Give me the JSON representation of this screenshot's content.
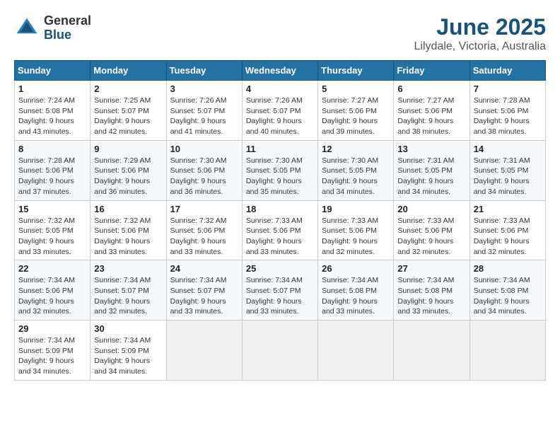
{
  "header": {
    "logo_general": "General",
    "logo_blue": "Blue",
    "month_title": "June 2025",
    "location": "Lilydale, Victoria, Australia"
  },
  "days_of_week": [
    "Sunday",
    "Monday",
    "Tuesday",
    "Wednesday",
    "Thursday",
    "Friday",
    "Saturday"
  ],
  "weeks": [
    [
      {
        "day": "1",
        "sunrise": "7:24 AM",
        "sunset": "5:08 PM",
        "daylight": "9 hours and 43 minutes."
      },
      {
        "day": "2",
        "sunrise": "7:25 AM",
        "sunset": "5:07 PM",
        "daylight": "9 hours and 42 minutes."
      },
      {
        "day": "3",
        "sunrise": "7:26 AM",
        "sunset": "5:07 PM",
        "daylight": "9 hours and 41 minutes."
      },
      {
        "day": "4",
        "sunrise": "7:26 AM",
        "sunset": "5:07 PM",
        "daylight": "9 hours and 40 minutes."
      },
      {
        "day": "5",
        "sunrise": "7:27 AM",
        "sunset": "5:06 PM",
        "daylight": "9 hours and 39 minutes."
      },
      {
        "day": "6",
        "sunrise": "7:27 AM",
        "sunset": "5:06 PM",
        "daylight": "9 hours and 38 minutes."
      },
      {
        "day": "7",
        "sunrise": "7:28 AM",
        "sunset": "5:06 PM",
        "daylight": "9 hours and 38 minutes."
      }
    ],
    [
      {
        "day": "8",
        "sunrise": "7:28 AM",
        "sunset": "5:06 PM",
        "daylight": "9 hours and 37 minutes."
      },
      {
        "day": "9",
        "sunrise": "7:29 AM",
        "sunset": "5:06 PM",
        "daylight": "9 hours and 36 minutes."
      },
      {
        "day": "10",
        "sunrise": "7:30 AM",
        "sunset": "5:06 PM",
        "daylight": "9 hours and 36 minutes."
      },
      {
        "day": "11",
        "sunrise": "7:30 AM",
        "sunset": "5:05 PM",
        "daylight": "9 hours and 35 minutes."
      },
      {
        "day": "12",
        "sunrise": "7:30 AM",
        "sunset": "5:05 PM",
        "daylight": "9 hours and 34 minutes."
      },
      {
        "day": "13",
        "sunrise": "7:31 AM",
        "sunset": "5:05 PM",
        "daylight": "9 hours and 34 minutes."
      },
      {
        "day": "14",
        "sunrise": "7:31 AM",
        "sunset": "5:05 PM",
        "daylight": "9 hours and 34 minutes."
      }
    ],
    [
      {
        "day": "15",
        "sunrise": "7:32 AM",
        "sunset": "5:05 PM",
        "daylight": "9 hours and 33 minutes."
      },
      {
        "day": "16",
        "sunrise": "7:32 AM",
        "sunset": "5:06 PM",
        "daylight": "9 hours and 33 minutes."
      },
      {
        "day": "17",
        "sunrise": "7:32 AM",
        "sunset": "5:06 PM",
        "daylight": "9 hours and 33 minutes."
      },
      {
        "day": "18",
        "sunrise": "7:33 AM",
        "sunset": "5:06 PM",
        "daylight": "9 hours and 33 minutes."
      },
      {
        "day": "19",
        "sunrise": "7:33 AM",
        "sunset": "5:06 PM",
        "daylight": "9 hours and 32 minutes."
      },
      {
        "day": "20",
        "sunrise": "7:33 AM",
        "sunset": "5:06 PM",
        "daylight": "9 hours and 32 minutes."
      },
      {
        "day": "21",
        "sunrise": "7:33 AM",
        "sunset": "5:06 PM",
        "daylight": "9 hours and 32 minutes."
      }
    ],
    [
      {
        "day": "22",
        "sunrise": "7:34 AM",
        "sunset": "5:06 PM",
        "daylight": "9 hours and 32 minutes."
      },
      {
        "day": "23",
        "sunrise": "7:34 AM",
        "sunset": "5:07 PM",
        "daylight": "9 hours and 32 minutes."
      },
      {
        "day": "24",
        "sunrise": "7:34 AM",
        "sunset": "5:07 PM",
        "daylight": "9 hours and 33 minutes."
      },
      {
        "day": "25",
        "sunrise": "7:34 AM",
        "sunset": "5:07 PM",
        "daylight": "9 hours and 33 minutes."
      },
      {
        "day": "26",
        "sunrise": "7:34 AM",
        "sunset": "5:08 PM",
        "daylight": "9 hours and 33 minutes."
      },
      {
        "day": "27",
        "sunrise": "7:34 AM",
        "sunset": "5:08 PM",
        "daylight": "9 hours and 33 minutes."
      },
      {
        "day": "28",
        "sunrise": "7:34 AM",
        "sunset": "5:08 PM",
        "daylight": "9 hours and 34 minutes."
      }
    ],
    [
      {
        "day": "29",
        "sunrise": "7:34 AM",
        "sunset": "5:09 PM",
        "daylight": "9 hours and 34 minutes."
      },
      {
        "day": "30",
        "sunrise": "7:34 AM",
        "sunset": "5:09 PM",
        "daylight": "9 hours and 34 minutes."
      },
      null,
      null,
      null,
      null,
      null
    ]
  ],
  "labels": {
    "sunrise": "Sunrise:",
    "sunset": "Sunset:",
    "daylight": "Daylight:"
  }
}
